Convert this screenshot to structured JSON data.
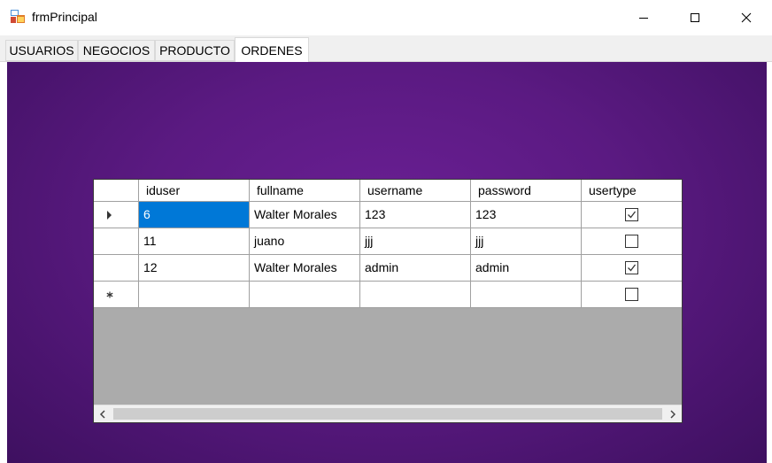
{
  "window": {
    "title": "frmPrincipal",
    "icon": "winforms-app-icon",
    "buttons": [
      "minimize-icon",
      "maximize-icon",
      "close-icon"
    ]
  },
  "tabs": [
    {
      "label": "USUARIOS",
      "active": false
    },
    {
      "label": "NEGOCIOS",
      "active": false
    },
    {
      "label": "PRODUCTO",
      "active": false
    },
    {
      "label": "ORDENES",
      "active": true
    }
  ],
  "colors": {
    "panel_bg": "#5b1a82",
    "selection": "#0078d7",
    "grid_empty_bg": "#ababab"
  },
  "grid": {
    "columns": [
      "iduser",
      "fullname",
      "username",
      "password",
      "usertype"
    ],
    "rows": [
      {
        "indicator": "current-row-arrow-icon",
        "iduser": "6",
        "fullname": "Walter Morales",
        "username": "123",
        "password": "123",
        "usertype": true
      },
      {
        "indicator": "",
        "iduser": "11",
        "fullname": "juano",
        "username": "jjj",
        "password": "jjj",
        "usertype": false
      },
      {
        "indicator": "",
        "iduser": "12",
        "fullname": "Walter Morales",
        "username": "admin",
        "password": "admin",
        "usertype": true
      }
    ],
    "new_row": {
      "indicator": "new-row-asterisk-icon",
      "usertype": false
    },
    "selected_cell": "iduser of row 1"
  },
  "scrollbar": {
    "left_icon": "scroll-left-icon",
    "right_icon": "scroll-right-icon"
  }
}
